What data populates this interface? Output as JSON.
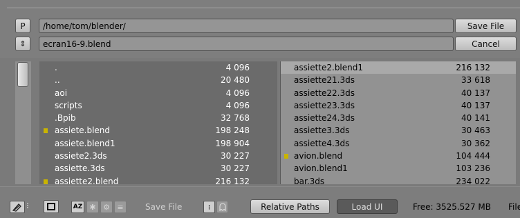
{
  "header": {
    "p_button": "P",
    "path": "/home/tom/blender/",
    "save_button": "Save File",
    "stepper_glyph": "⇕",
    "filename": "ecran16-9.blend",
    "cancel_button": "Cancel"
  },
  "files_left": [
    {
      "name": ".",
      "size": "4 096",
      "marked": false
    },
    {
      "name": "..",
      "size": "20 480",
      "marked": false
    },
    {
      "name": "aoi",
      "size": "4 096",
      "marked": false
    },
    {
      "name": "scripts",
      "size": "4 096",
      "marked": false
    },
    {
      "name": ".Bpib",
      "size": "32 768",
      "marked": false
    },
    {
      "name": "assiete.blend",
      "size": "198 248",
      "marked": true
    },
    {
      "name": "assiete.blend1",
      "size": "198 904",
      "marked": false
    },
    {
      "name": "assiete2.3ds",
      "size": "30 227",
      "marked": false
    },
    {
      "name": "assiette.3ds",
      "size": "30 227",
      "marked": false
    },
    {
      "name": "assiette2.blend",
      "size": "216 132",
      "marked": true
    }
  ],
  "files_right": [
    {
      "name": "assiette2.blend1",
      "size": "216 132",
      "marked": false,
      "selected": true
    },
    {
      "name": "assiette21.3ds",
      "size": "33 618",
      "marked": false
    },
    {
      "name": "assiette22.3ds",
      "size": "40 137",
      "marked": false
    },
    {
      "name": "assiette23.3ds",
      "size": "40 137",
      "marked": false
    },
    {
      "name": "assiette24.3ds",
      "size": "40 141",
      "marked": false
    },
    {
      "name": "assiette3.3ds",
      "size": "30 463",
      "marked": false
    },
    {
      "name": "assiette4.3ds",
      "size": "30 362",
      "marked": false
    },
    {
      "name": "avion.blend",
      "size": "104 444",
      "marked": true
    },
    {
      "name": "avion.blend1",
      "size": "103 236",
      "marked": false
    },
    {
      "name": "bar.3ds",
      "size": "234 022",
      "marked": false
    }
  ],
  "footer": {
    "sort_alpha_label": "AZ",
    "save_file_label": "Save File",
    "relative_paths": "Relative Paths",
    "load_ui": "Load UI",
    "free_space": "Free: 3525.527 MB",
    "trailing_text": "File"
  },
  "colors": {
    "mark": "#c9b400",
    "panel_dark": "#6b6b6b",
    "panel_light": "#929292"
  }
}
